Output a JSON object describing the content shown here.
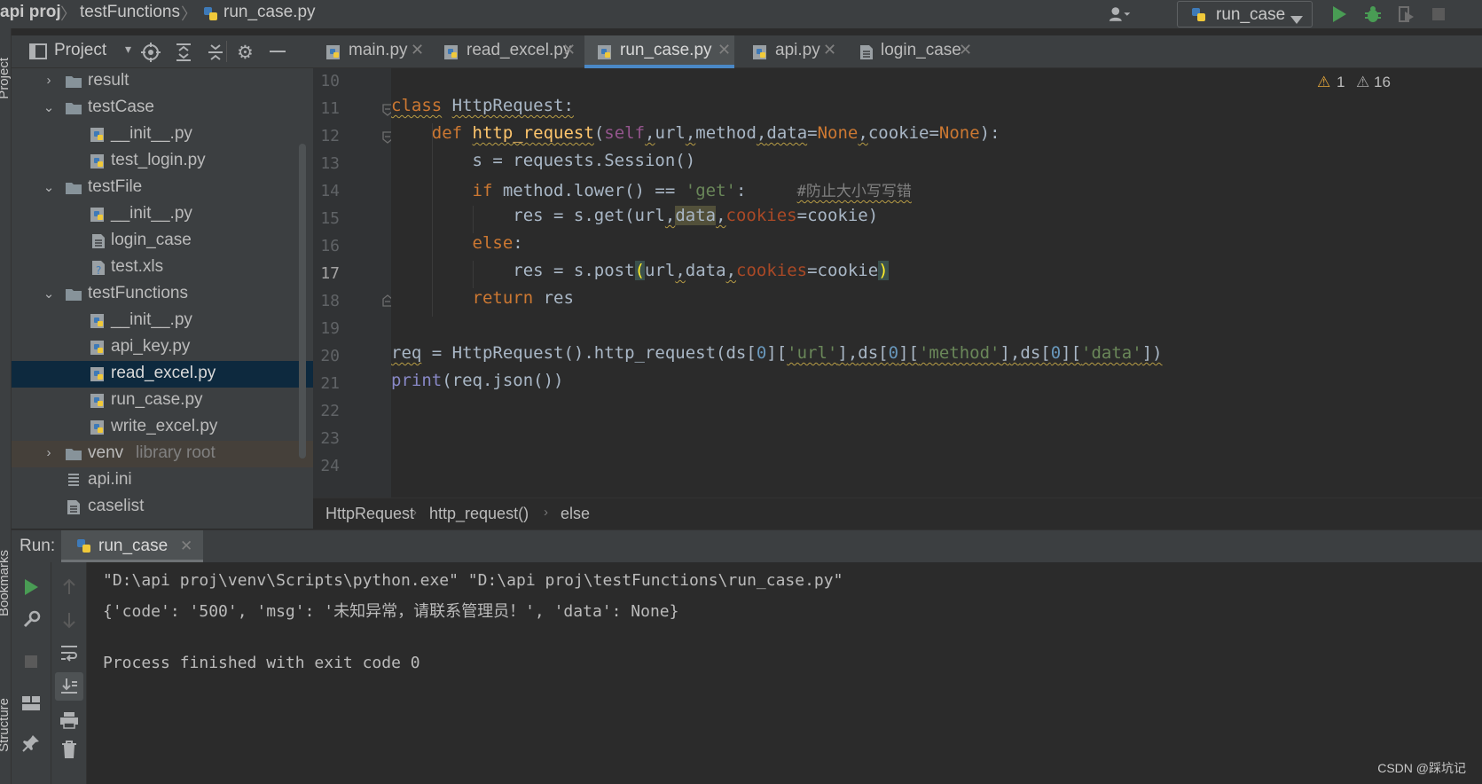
{
  "nav": {
    "crumbs": [
      "api proj",
      "testFunctions",
      "run_case.py"
    ],
    "run_config": "run_case"
  },
  "side_labels": {
    "project": "Project",
    "bookmarks": "Bookmarks",
    "structure": "Structure"
  },
  "project_panel": {
    "title": "Project",
    "tree": [
      {
        "label": "result",
        "kind": "folder",
        "expanded": false,
        "depth": 1
      },
      {
        "label": "testCase",
        "kind": "folder",
        "expanded": true,
        "depth": 1
      },
      {
        "label": "__init__.py",
        "kind": "py",
        "depth": 2
      },
      {
        "label": "test_login.py",
        "kind": "py",
        "depth": 2
      },
      {
        "label": "testFile",
        "kind": "folder",
        "expanded": true,
        "depth": 1
      },
      {
        "label": "__init__.py",
        "kind": "py",
        "depth": 2
      },
      {
        "label": "login_case",
        "kind": "text",
        "depth": 2
      },
      {
        "label": "test.xls",
        "kind": "unknown",
        "depth": 2
      },
      {
        "label": "testFunctions",
        "kind": "folder",
        "expanded": true,
        "depth": 1
      },
      {
        "label": "__init__.py",
        "kind": "py",
        "depth": 2
      },
      {
        "label": "api_key.py",
        "kind": "py",
        "depth": 2
      },
      {
        "label": "read_excel.py",
        "kind": "py",
        "depth": 2,
        "selected": true
      },
      {
        "label": "run_case.py",
        "kind": "py",
        "depth": 2
      },
      {
        "label": "write_excel.py",
        "kind": "py",
        "depth": 2
      },
      {
        "label": "venv",
        "sublabel": "library root",
        "kind": "folder",
        "expanded": false,
        "depth": 1,
        "highlight": true
      },
      {
        "label": "api.ini",
        "kind": "ini",
        "depth": 1
      },
      {
        "label": "caselist",
        "kind": "text",
        "depth": 1
      }
    ]
  },
  "tabs": [
    {
      "label": "main.py",
      "icon": "python"
    },
    {
      "label": "read_excel.py",
      "icon": "python"
    },
    {
      "label": "run_case.py",
      "icon": "python",
      "active": true
    },
    {
      "label": "api.py",
      "icon": "python"
    },
    {
      "label": "login_case",
      "icon": "text"
    }
  ],
  "editor": {
    "line_numbers": [
      "10",
      "11",
      "12",
      "13",
      "14",
      "15",
      "16",
      "17",
      "18",
      "19",
      "20",
      "21",
      "22",
      "23",
      "24"
    ],
    "current_line": "17",
    "warnings": {
      "warning_count": "1",
      "weak_warning_count": "16"
    },
    "code": {
      "l11": [
        "class",
        "HttpRequest",
        ":"
      ],
      "l12": [
        "def",
        "http_request",
        "(",
        "self",
        ",",
        "url",
        ",",
        "method",
        ",",
        "data",
        "=",
        "None",
        ",",
        "cookie",
        "=",
        "None",
        "):"
      ],
      "l13": "s = requests.Session()",
      "l14": [
        "if",
        " method.lower() == ",
        "'get'",
        ":",
        "#防止大小写写错"
      ],
      "l15": [
        "res = s.get(url",
        ",",
        "data",
        ",",
        "cookies",
        "=cookie)"
      ],
      "l16": [
        "else",
        ":"
      ],
      "l17": [
        "res = s.post",
        "(",
        "url",
        ",",
        "data",
        ",",
        "cookies",
        "=cookie",
        ")"
      ],
      "l18": [
        "return",
        " res"
      ],
      "l20": [
        "req",
        " = HttpRequest().http_request(ds[",
        "0",
        "][",
        "'url'",
        "]",
        ",",
        "ds[",
        "0",
        "][",
        "'method'",
        "]",
        ",",
        "ds[",
        "0",
        "][",
        "'data'",
        "])"
      ],
      "l21": [
        "print",
        "(req.json())"
      ]
    },
    "breadcrumb": [
      "HttpRequest",
      "http_request()",
      "else"
    ]
  },
  "run": {
    "label": "Run:",
    "tab": "run_case",
    "console": [
      "\"D:\\api proj\\venv\\Scripts\\python.exe\" \"D:\\api proj\\testFunctions\\run_case.py\"",
      "{'code': '500', 'msg': '未知异常，请联系管理员！', 'data': None}",
      "",
      "Process finished with exit code 0"
    ]
  },
  "watermark": "CSDN @踩坑记",
  "colors": {
    "accent": "#4a88c7",
    "run_green": "#499c54",
    "keyword": "#cc7832",
    "function": "#ffc66d",
    "string": "#6a8759",
    "number": "#6897bb",
    "warning": "#e2a53a"
  }
}
